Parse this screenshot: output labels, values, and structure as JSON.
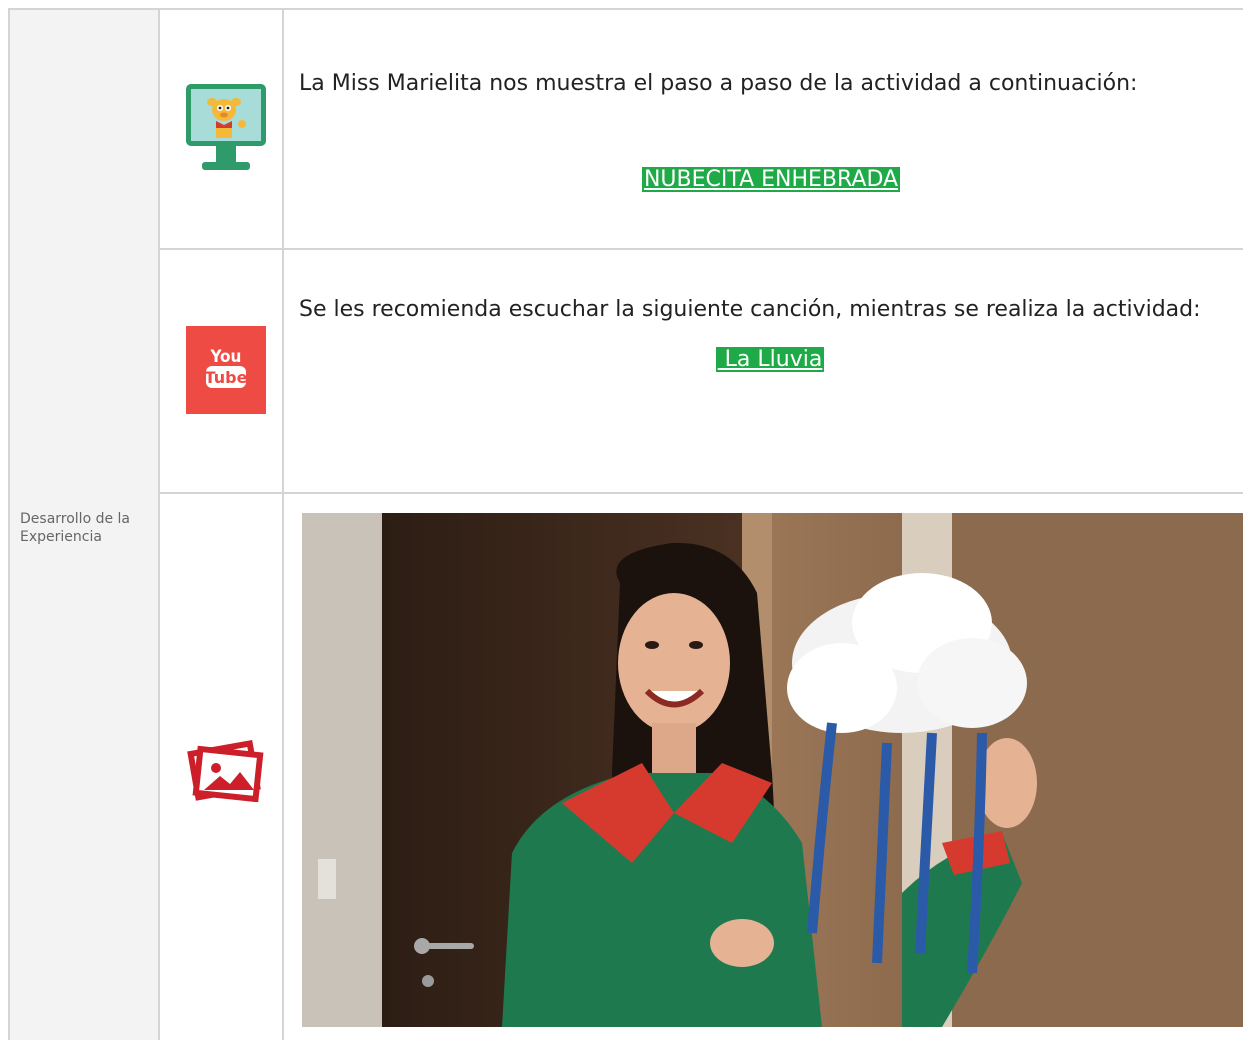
{
  "row_label": "Desarrollo de la Experiencia",
  "rows": [
    {
      "icon": "video-monitor-icon",
      "text": "La Miss Marielita nos muestra el paso a paso de la actividad a continuación:",
      "link_text": "NUBECITA ENHEBRADA"
    },
    {
      "icon": "youtube-icon",
      "youtube_you": "You",
      "youtube_tube": "Tube",
      "text": "Se les recomienda escuchar la siguiente canción, mientras se realiza la actividad:",
      "link_text": " La Lluvia"
    },
    {
      "icon": "image-gallery-icon"
    }
  ],
  "colors": {
    "link_background": "#1faa48",
    "youtube_red": "#ef4b45",
    "image_icon_red": "#cc1f2a",
    "monitor_green": "#2f9a6a"
  }
}
